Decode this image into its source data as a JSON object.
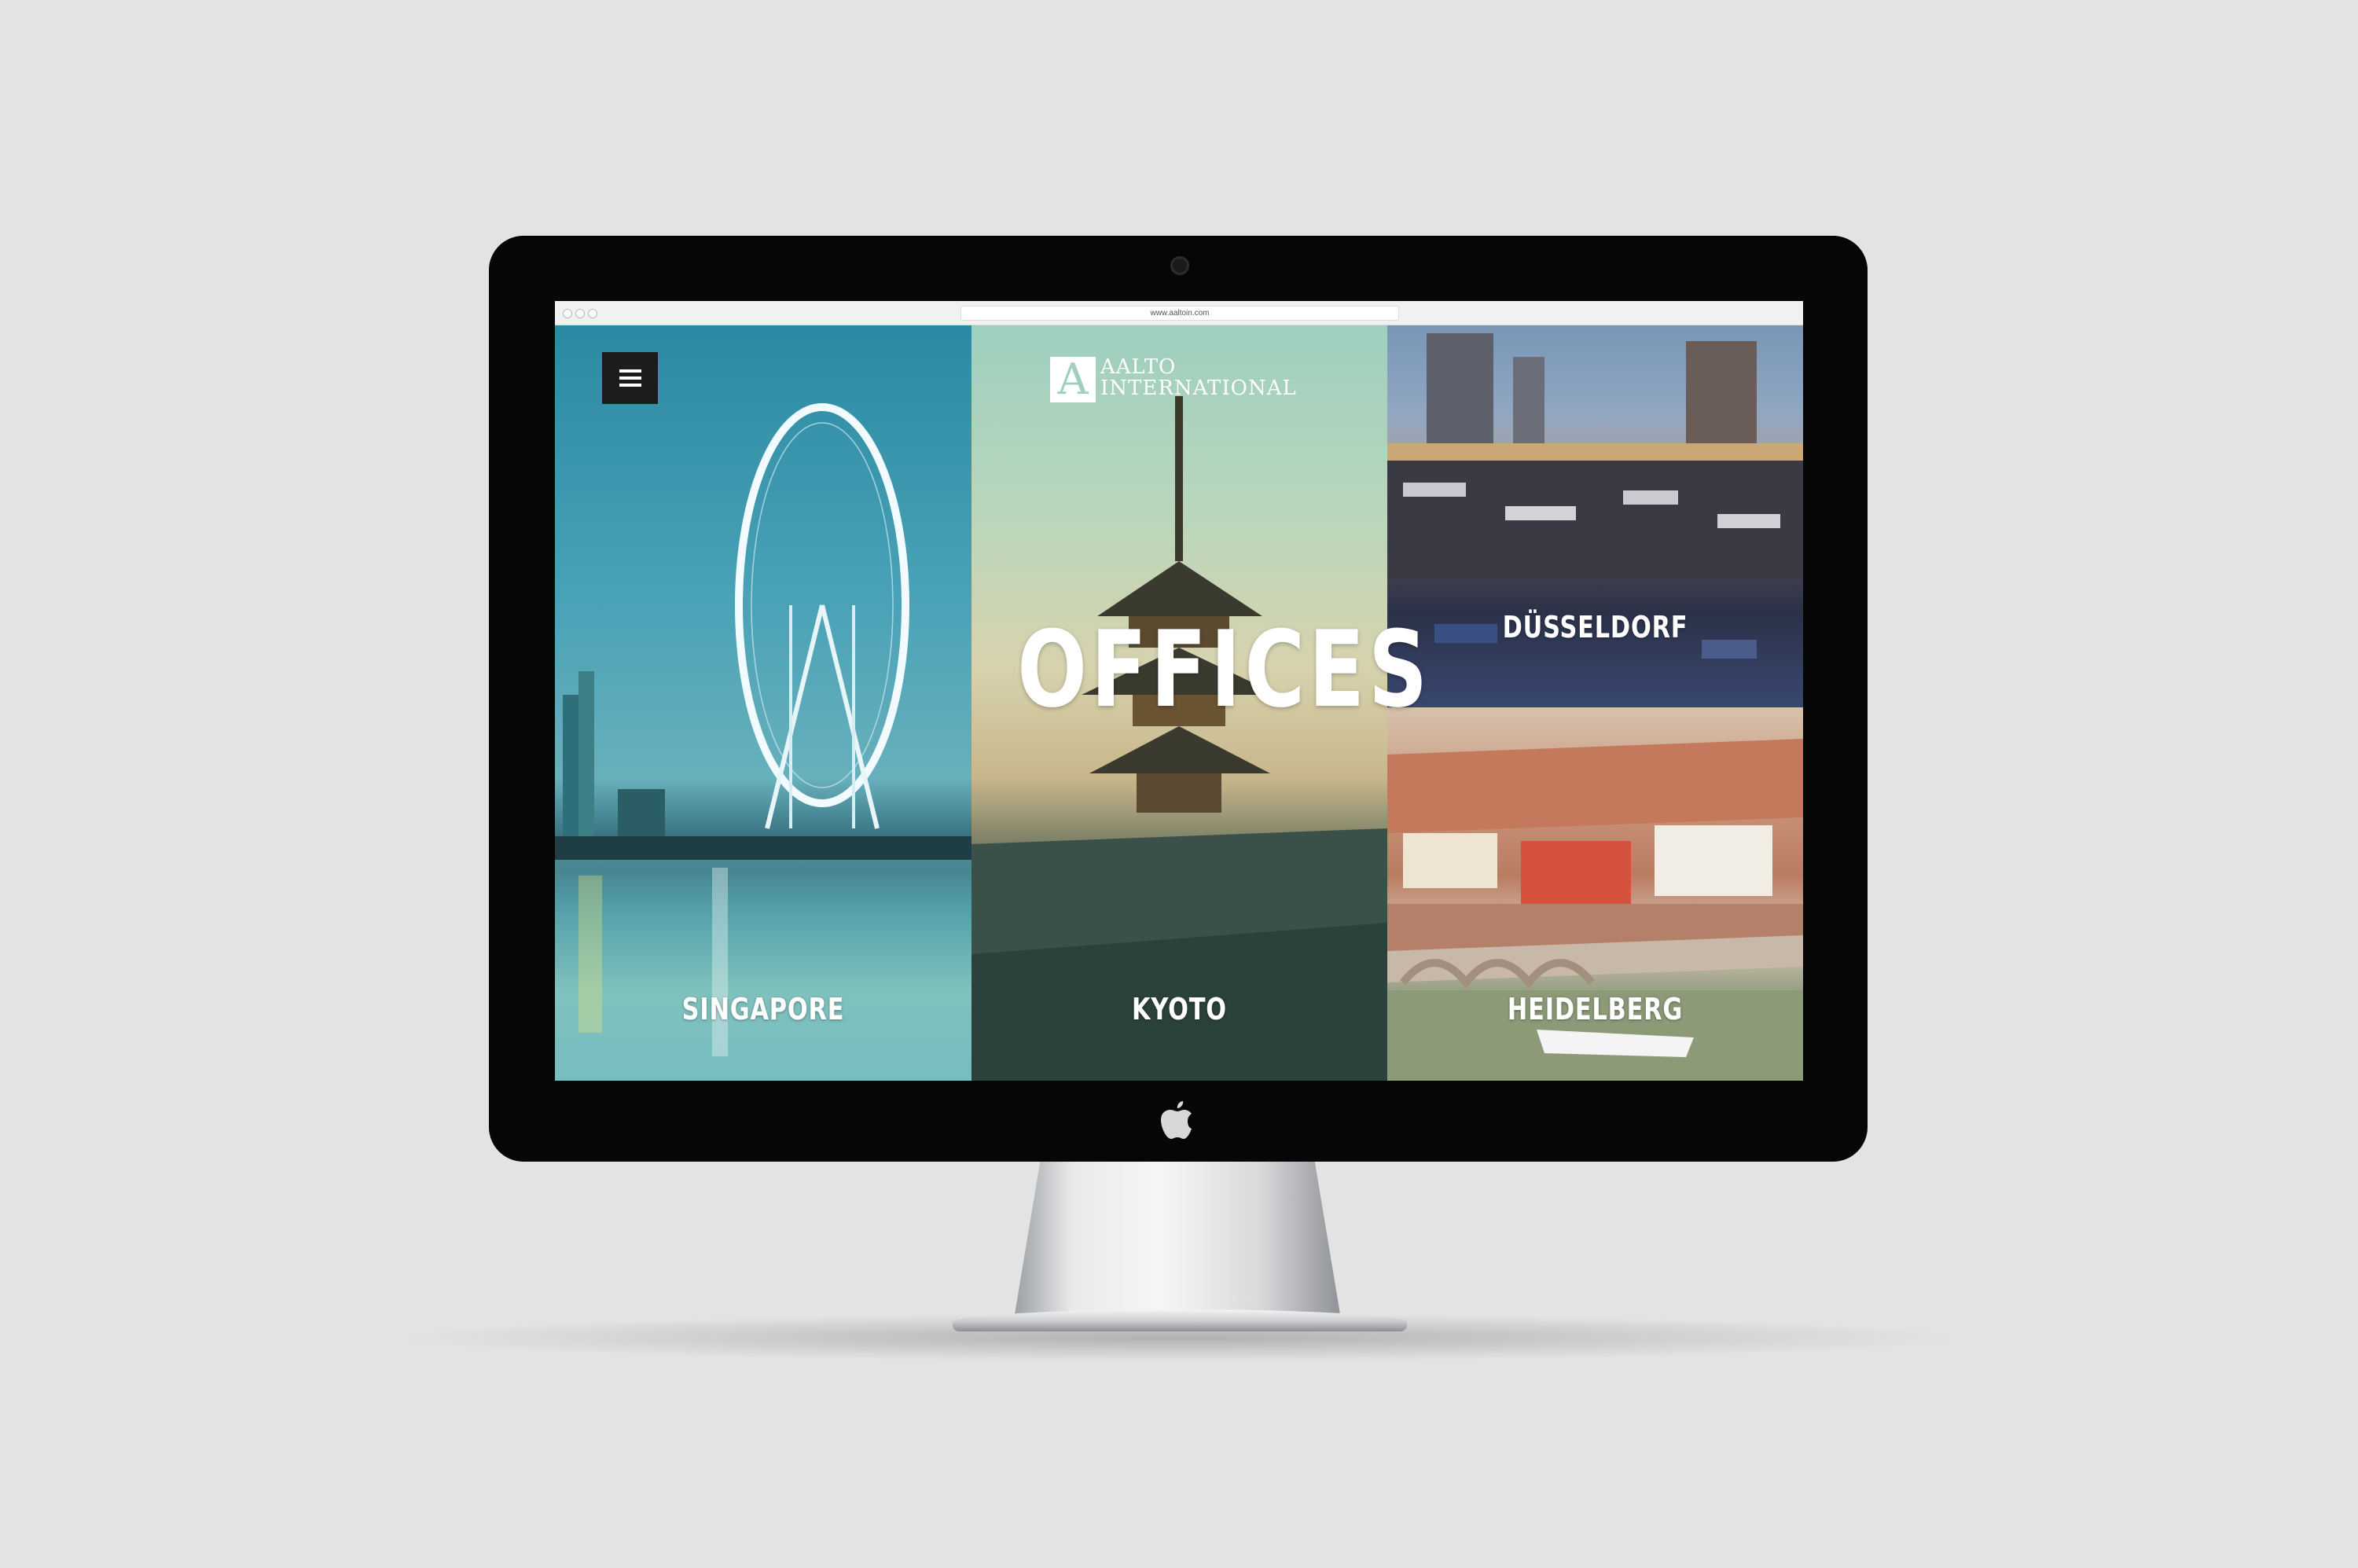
{
  "browser": {
    "url": "www.aaltoin.com"
  },
  "brand": {
    "logo_mark": "A",
    "logo_line1": "AALTO",
    "logo_line2": "INTERNATIONAL"
  },
  "page": {
    "heading": "OFFICES"
  },
  "offices": [
    {
      "city": "SINGAPORE"
    },
    {
      "city": "KYOTO"
    },
    {
      "city": "DÜSSELDORF"
    },
    {
      "city": "HEIDELBERG"
    }
  ],
  "colors": {
    "background": "#e3e3e3",
    "bezel": "#060606",
    "menu_button": "#1c1c1c",
    "text": "#ffffff"
  },
  "icons": {
    "menu": "hamburger-icon",
    "device_logo": "apple-logo-icon"
  }
}
